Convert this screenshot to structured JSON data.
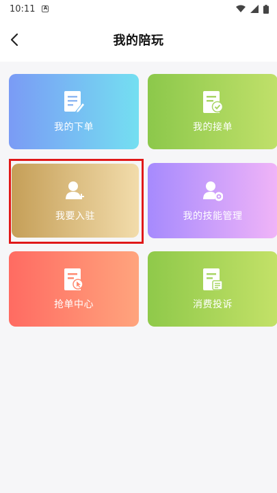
{
  "status_bar": {
    "time": "10:11",
    "notification_glyph": "A"
  },
  "header": {
    "title": "我的陪玩"
  },
  "cards": [
    {
      "label": "我的下单",
      "icon": "document-edit-icon"
    },
    {
      "label": "我的接单",
      "icon": "document-check-icon"
    },
    {
      "label": "我要入驻",
      "icon": "user-add-icon"
    },
    {
      "label": "我的技能管理",
      "icon": "user-settings-icon"
    },
    {
      "label": "抢单中心",
      "icon": "document-click-icon"
    },
    {
      "label": "消费投诉",
      "icon": "complaint-icon"
    }
  ],
  "colors": {
    "highlight": "#e01818"
  }
}
